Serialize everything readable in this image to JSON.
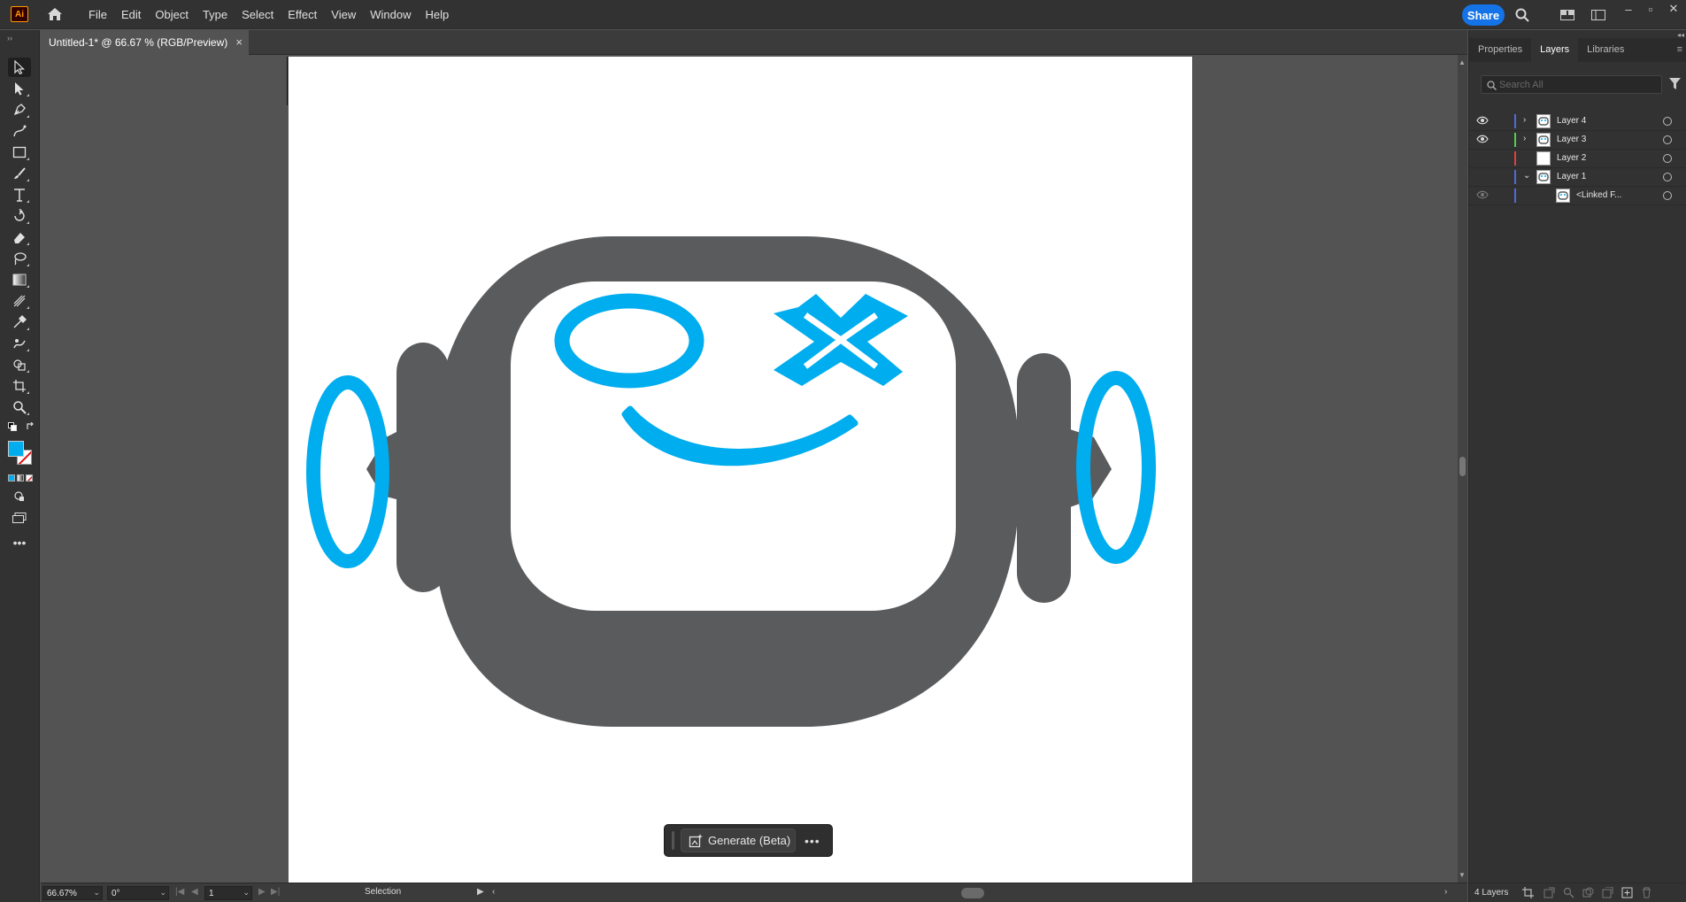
{
  "app": {
    "logo_text": "Ai",
    "menu": [
      "File",
      "Edit",
      "Object",
      "Type",
      "Select",
      "Effect",
      "View",
      "Window",
      "Help"
    ],
    "share_label": "Share",
    "accent": "#1473e6"
  },
  "document": {
    "tab_title": "Untitled-1* @ 66.67 % (RGB/Preview)",
    "tab_close": "×"
  },
  "artwork": {
    "robot_body_color": "#5a5b5d",
    "accent_color": "#00adef",
    "face_color": "#ffffff"
  },
  "generate_bar": {
    "button_label": "Generate (Beta)",
    "more_label": "•••"
  },
  "status": {
    "zoom": "66.67%",
    "rotation": "0°",
    "artboard_number": "1",
    "tool_name": "Selection"
  },
  "panel": {
    "tabs": [
      "Properties",
      "Layers",
      "Libraries"
    ],
    "active_tab": "Layers",
    "search_placeholder": "Search All",
    "layers": [
      {
        "name": "Layer 4",
        "visible": true,
        "color": "#4f6bdb",
        "expandable": "›"
      },
      {
        "name": "Layer 3",
        "visible": true,
        "color": "#4fcf4f",
        "expandable": "›"
      },
      {
        "name": "Layer 2",
        "visible": false,
        "color": "#e04040",
        "expandable": ""
      },
      {
        "name": "Layer 1",
        "visible": false,
        "color": "#4f6bdb",
        "expandable": "⌄"
      },
      {
        "name": "<Linked F...",
        "visible": true,
        "dim": true,
        "color": "#4f6bdb",
        "expandable": ""
      }
    ],
    "layer_count": "4 Layers"
  }
}
